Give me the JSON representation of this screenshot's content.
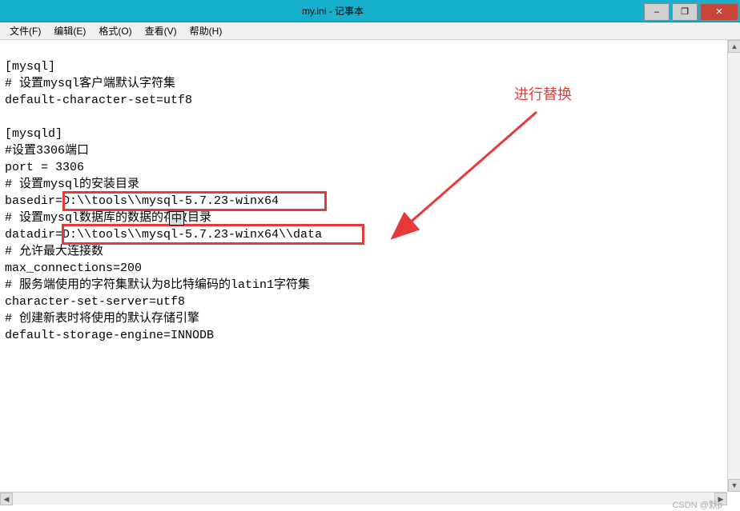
{
  "titlebar": {
    "title": "my.ini - 记事本",
    "min": "–",
    "max": "❐",
    "close": "✕"
  },
  "menu": {
    "file": "文件(F)",
    "edit": "编辑(E)",
    "format": "格式(O)",
    "view": "查看(V)",
    "help": "帮助(H)"
  },
  "content": {
    "line1": "[mysql]",
    "line2": "# 设置mysql客户端默认字符集",
    "line3": "default-character-set=utf8",
    "line4": "",
    "line5": "[mysqld]",
    "line6": "#设置3306端口",
    "line7": "port = 3306",
    "line8": "# 设置mysql的安装目录",
    "line9": "basedir=D:\\\\tools\\\\mysql-5.7.23-winx64",
    "line10": "# 设置mysql数据库的数据的存放目录",
    "line11": "datadir=D:\\\\tools\\\\mysql-5.7.23-winx64\\\\data",
    "line12": "# 允许最大连接数",
    "line13": "max_connections=200",
    "line14": "# 服务端使用的字符集默认为8比特编码的latin1字符集",
    "line15": "character-set-server=utf8",
    "line16": "# 创建新表时将使用的默认存储引擎",
    "line17": "default-storage-engine=INNODB"
  },
  "annotation": {
    "text": "进行替换"
  },
  "footer": {
    "watermark": "CSDN @默p"
  },
  "cursor": "中"
}
